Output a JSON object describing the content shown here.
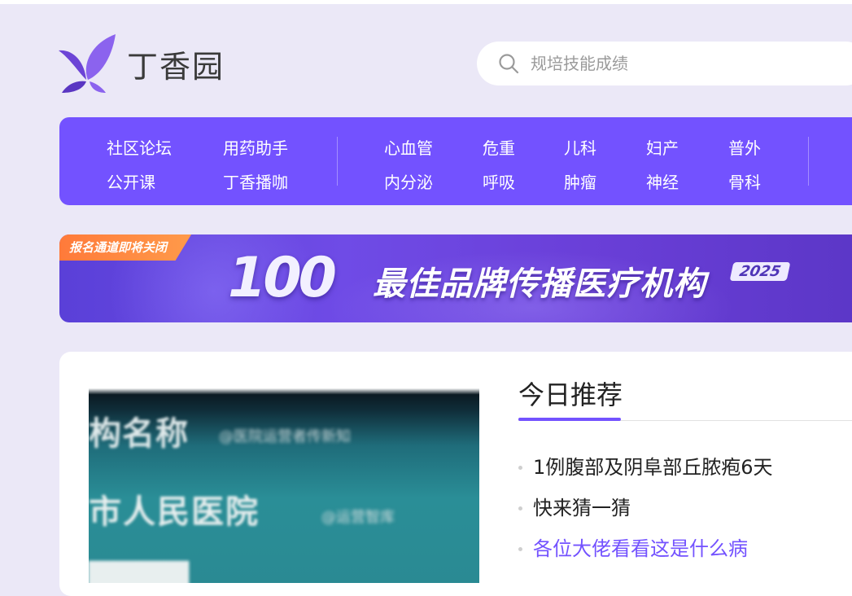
{
  "site": {
    "logo_text": "丁香园"
  },
  "search": {
    "placeholder": "规培技能成绩"
  },
  "nav": {
    "left": [
      [
        "社区论坛",
        "用药助手"
      ],
      [
        "公开课",
        "丁香播咖"
      ]
    ],
    "departments": [
      [
        "心血管",
        "危重",
        "儿科",
        "妇产",
        "普外"
      ],
      [
        "内分泌",
        "呼吸",
        "肿瘤",
        "神经",
        "骨科"
      ]
    ]
  },
  "banner": {
    "badge": "报名通道即将关闭",
    "number": "100",
    "title": "最佳品牌传播医疗机构",
    "year": "2025"
  },
  "thumbnail": {
    "line1": "构名称",
    "line1_sub": "@医院运营者传新知",
    "line2": "市人民医院",
    "line2_sub": "@运营智库"
  },
  "recommend": {
    "title": "今日推荐",
    "items": [
      "1例腹部及阴阜部丘脓疱6天",
      "快来猜一猜",
      "各位大佬看看这是什么病"
    ]
  },
  "colors": {
    "accent": "#7352ff",
    "page_bg": "#ebe8f7",
    "badge": "#ff8a40"
  }
}
